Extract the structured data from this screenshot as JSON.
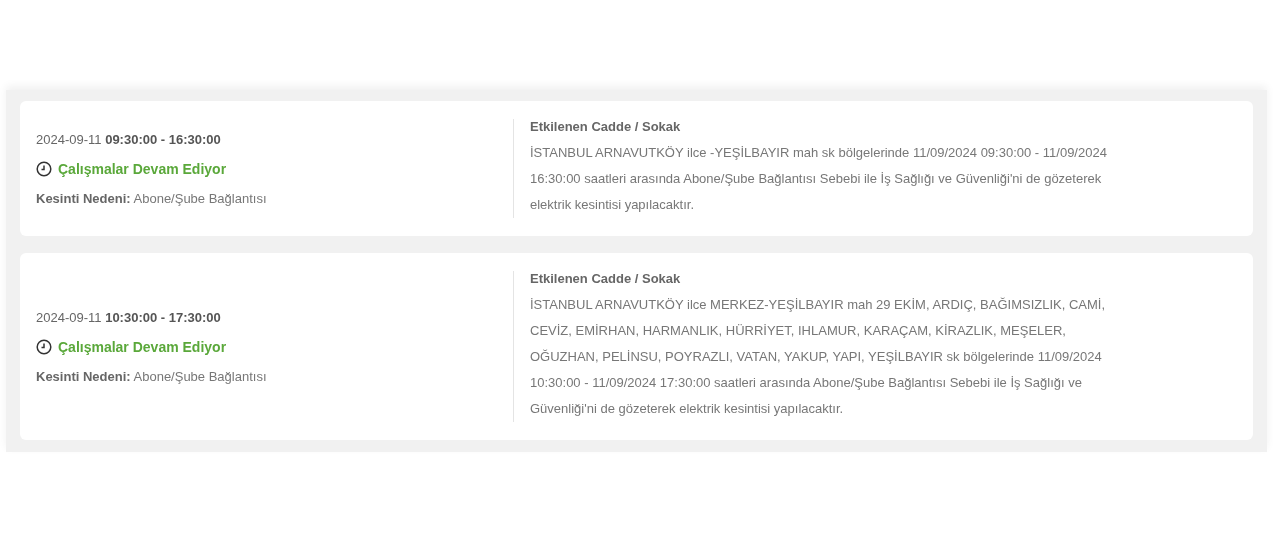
{
  "outages": [
    {
      "date_time": "2024-09-11 **09:30:00 - 16:30:00**",
      "status": "Çalışmalar Devam Ediyor",
      "reason": "**Kesinti Nedeni:** Abone/Şube Bağlantısı",
      "heading": "Etkilenen Cadde / Sokak",
      "description": "İSTANBUL ARNAVUTKÖY ilce -YEŞİLBAYIR mah sk bölgelerinde 11/09/2024 09:30:00 - 11/09/2024 16:30:00 saatleri arasında Abone/Şube Bağlantısı Sebebi ile İş Sağlığı ve Güvenliği'ni de gözeterek elektrik kesintisi yapılacaktır."
    },
    {
      "date_time": "2024-09-11 **10:30:00 - 17:30:00**",
      "status": "Çalışmalar Devam Ediyor",
      "reason": "**Kesinti Nedeni:** Abone/Şube Bağlantısı",
      "heading": "Etkilenen Cadde / Sokak",
      "description": "İSTANBUL ARNAVUTKÖY ilce MERKEZ-YEŞİLBAYIR mah 29 EKİM, ARDIÇ, BAĞIMSIZLIK, CAMİ, CEVİZ, EMİRHAN, HARMANLIK, HÜRRİYET, IHLAMUR, KARAÇAM, KİRAZLIK, MEŞELER, OĞUZHAN, PELİNSU, POYRAZLI, VATAN, YAKUP, YAPI, YEŞİLBAYIR sk bölgelerinde 11/09/2024 10:30:00 - 11/09/2024 17:30:00 saatleri arasında Abone/Şube Bağlantısı Sebebi ile İş Sağlığı ve Güvenliği'ni de gözeterek elektrik kesintisi yapılacaktır."
    }
  ]
}
